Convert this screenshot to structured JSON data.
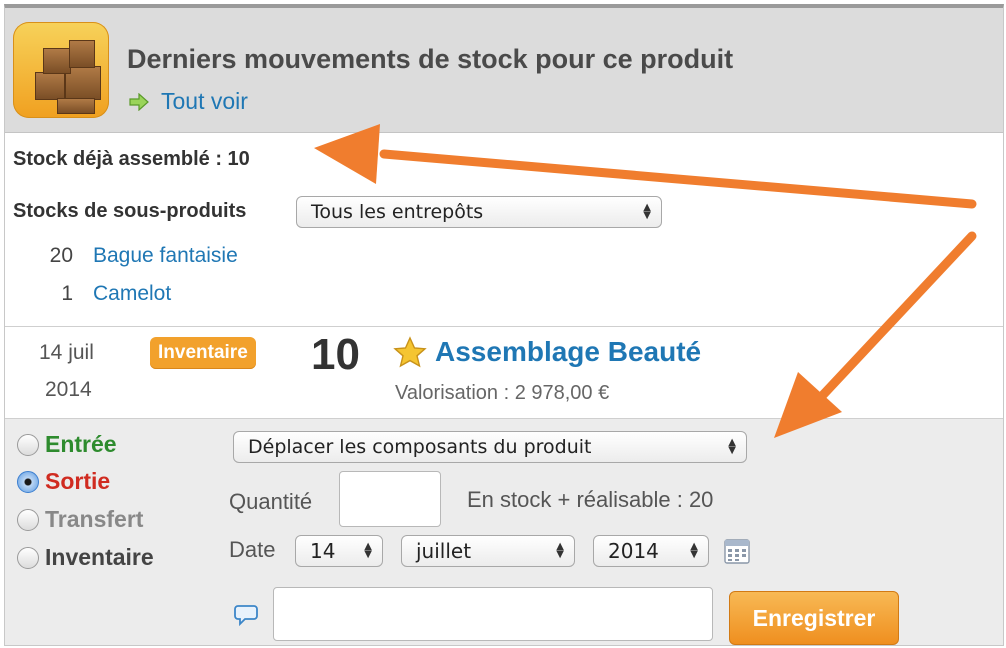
{
  "header": {
    "title": "Derniers mouvements de stock pour ce produit",
    "see_all": "Tout voir",
    "icon": "boxes-icon"
  },
  "stock": {
    "assembled": "Stock déjà assemblé : 10",
    "sub_products_label": "Stocks de sous-produits",
    "warehouse_select": "Tous les entrepôts",
    "sub_products": [
      {
        "qty": "20",
        "name": "Bague fantaisie"
      },
      {
        "qty": "1",
        "name": "Camelot"
      }
    ]
  },
  "movement": {
    "date_day": "14 juil",
    "date_year": "2014",
    "badge": "Inventaire",
    "qty": "10",
    "title": "Assemblage Beauté",
    "valuation": "Valorisation : 2 978,00 €"
  },
  "form": {
    "types": [
      {
        "label": "Entrée",
        "selected": false
      },
      {
        "label": "Sortie",
        "selected": true
      },
      {
        "label": "Transfert",
        "selected": false
      },
      {
        "label": "Inventaire",
        "selected": false
      }
    ],
    "action_select": "Déplacer les composants du produit",
    "qty_label": "Quantité",
    "qty_value": "",
    "instock": "En stock + réalisable : 20",
    "date_label": "Date",
    "day": "14",
    "month": "juillet",
    "year": "2014",
    "comment": "",
    "save": "Enregistrer"
  },
  "colors": {
    "link": "#1f77b4",
    "badge": "#f2a12c",
    "entree": "#2e8b2e",
    "sortie": "#d02b20",
    "annotation_arrow": "#f07d2e"
  }
}
